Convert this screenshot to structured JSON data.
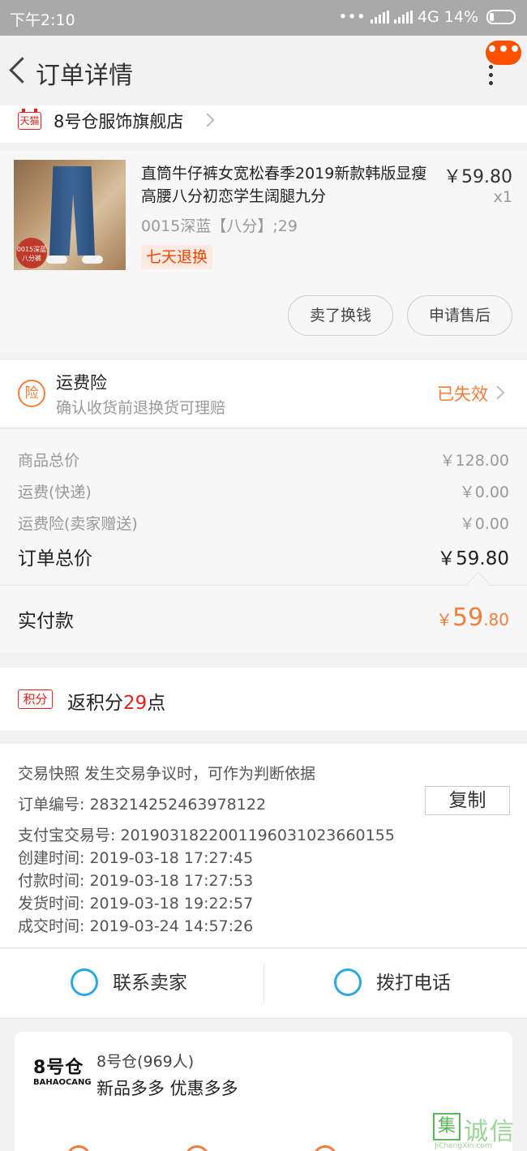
{
  "status_bar": {
    "time": "下午2:10",
    "network": "4G",
    "battery": "14%"
  },
  "header": {
    "title": "订单详情",
    "more_badge": "•••"
  },
  "store": {
    "badge": "天猫",
    "name": "8号仓服饰旗舰店"
  },
  "product": {
    "name": "直筒牛仔裤女宽松春季2019新款韩版显瘦高腰八分初恋学生阔腿九分",
    "price": "￥59.80",
    "quantity": "x1",
    "sku": "0015深蓝【八分】;29",
    "thumb_badge": "0015深蓝 八分裤",
    "return_tag": "七天退换",
    "sell_button": "卖了换钱",
    "aftersale_button": "申请售后"
  },
  "insurance": {
    "icon_text": "险",
    "title": "运费险",
    "subtitle": "确认收货前退换货可理赔",
    "status": "已失效"
  },
  "totals": [
    {
      "label": "商品总价",
      "value": "￥128.00"
    },
    {
      "label": "运费(快递)",
      "value": "￥0.00"
    },
    {
      "label": "运费险(卖家赠送)",
      "value": "￥0.00"
    },
    {
      "label": "订单总价",
      "value": "￥59.80"
    }
  ],
  "payment": {
    "label": "实付款",
    "currency": "￥",
    "integer": "59",
    "decimal": ".80"
  },
  "points": {
    "tag": "积分",
    "prefix": "返积分",
    "number": "29",
    "suffix": "点"
  },
  "order_info": {
    "snapshot": "交易快照   发生交易争议时，可作为判断依据",
    "order_no": "订单编号:   283214252463978122",
    "copy_button": "复制",
    "alipay_no": "支付宝交易号:   2019031822001196031023660155",
    "created": "创建时间:   2019-03-18 17:27:45",
    "paid": "付款时间:   2019-03-18 17:27:53",
    "shipped": "发货时间:   2019-03-18 19:22:57",
    "completed": "成交时间:   2019-03-24 14:57:26"
  },
  "actions": {
    "contact_seller": "联系卖家",
    "call_phone": "拨打电话"
  },
  "shop_card": {
    "logo_big": "8号仓",
    "logo_small": "BAHAOCANG",
    "name": "8号仓(969人)",
    "slogan": "新品多多 优惠多多"
  },
  "watermark": {
    "box": "集",
    "text": "诚信",
    "url": "JiChengXin.com"
  },
  "colors": {
    "accent": "#ff5000",
    "orange": "#f57d3c",
    "red": "#e8211d",
    "blue": "#2ea7e0"
  }
}
